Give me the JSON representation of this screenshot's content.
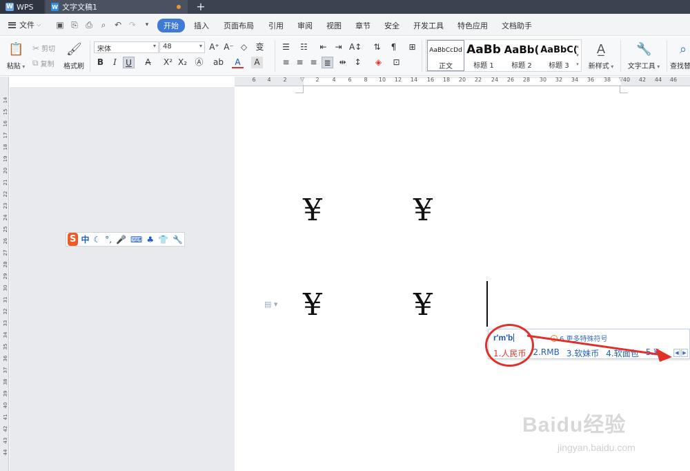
{
  "titlebar": {
    "app_tab": "WPS",
    "doc_tab": "文字文稿1",
    "new_tab_symbol": "+"
  },
  "menu": {
    "file": "文件",
    "tabs": [
      "开始",
      "插入",
      "页面布局",
      "引用",
      "审阅",
      "视图",
      "章节",
      "安全",
      "开发工具",
      "特色应用",
      "文档助手"
    ],
    "active_tab": "开始"
  },
  "ribbon": {
    "paste": "粘贴",
    "cut": "剪切",
    "copy": "复制",
    "format_painter": "格式刷",
    "font_name": "宋体",
    "font_size": "48",
    "styles": [
      {
        "sample": "AaBbCcDd",
        "name": "正文"
      },
      {
        "sample": "AaBb",
        "name": "标题 1"
      },
      {
        "sample": "AaBb(",
        "name": "标题 2"
      },
      {
        "sample": "AaBbC(",
        "name": "标题 3"
      }
    ],
    "new_style": "新样式",
    "text_tools": "文字工具",
    "find": "查找替"
  },
  "ruler": {
    "labels": [
      "6",
      "4",
      "2",
      "2",
      "4",
      "6",
      "8",
      "10",
      "12",
      "14",
      "16",
      "18",
      "20",
      "22",
      "24",
      "26",
      "28",
      "30",
      "32",
      "34",
      "36",
      "38",
      "40",
      "42",
      "44",
      "46"
    ],
    "vlabels": [
      "14",
      "15",
      "16",
      "17",
      "18",
      "19",
      "20",
      "21",
      "22",
      "23",
      "24",
      "25",
      "26",
      "27",
      "28",
      "29",
      "30",
      "31",
      "32",
      "33",
      "34",
      "35",
      "36",
      "37",
      "38",
      "39",
      "40",
      "41",
      "42",
      "43",
      "44"
    ]
  },
  "document": {
    "symbols": [
      "¥",
      "¥",
      "¥",
      "¥"
    ]
  },
  "ime_toolbar": {
    "logo": "S",
    "mode": "中",
    "icons": [
      "moon-icon",
      "punctuation-icon",
      "microphone-icon",
      "keyboard-icon",
      "skin-icon",
      "shirt-icon",
      "wrench-icon"
    ]
  },
  "ime_candidates": {
    "input": "r'm'b",
    "more_symbols": "6.更多特殊符号",
    "items": [
      "1.人民币",
      "2.RMB",
      "3.软妹币",
      "4.软面包",
      "5.¥"
    ]
  },
  "watermark": {
    "main": "Baidu经验",
    "sub": "jingyan.baidu.com"
  },
  "colors": {
    "accent": "#3f7bd6",
    "highlight_red": "#e0302a",
    "candidate_blue": "#1f5fc0"
  }
}
